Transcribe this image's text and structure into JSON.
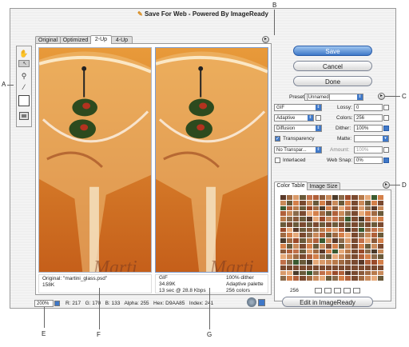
{
  "window": {
    "title": "Save For Web - Powered By ImageReady"
  },
  "tabs": [
    "Original",
    "Optimized",
    "2-Up",
    "4-Up"
  ],
  "active_tab": "2-Up",
  "tools": [
    "hand-icon",
    "slice-select-icon",
    "zoom-icon",
    "eyedropper-icon",
    "eyedropper-color-icon",
    "toggle-slices-icon"
  ],
  "left_pane": {
    "line1": "Original: \"martini_glass.psd\"",
    "line2": "158K",
    "watermark": "Marti"
  },
  "right_pane": {
    "col1": [
      "GIF",
      "34.89K",
      "13 sec @ 28.8 Kbps"
    ],
    "col2": [
      "100% dither",
      "Adaptive palette",
      "256 colors"
    ],
    "watermark": "Marti"
  },
  "buttons": {
    "save": "Save",
    "cancel": "Cancel",
    "done": "Done",
    "edit_imageready": "Edit in ImageReady"
  },
  "settings": {
    "preset_label": "Preset:",
    "preset_value": "[Unnamed]",
    "format": "GIF",
    "lossy_label": "Lossy:",
    "lossy_value": "0",
    "palette": "Adaptive",
    "colors_label": "Colors:",
    "colors_value": "256",
    "dither_algo": "Diffusion",
    "dither_label": "Dither:",
    "dither_value": "100%",
    "transparency_label": "Transparency",
    "matte_label": "Matte:",
    "transparency_dither": "No Transpar...",
    "amount_label": "Amount:",
    "amount_value": "100%",
    "interlaced_label": "Interlaced",
    "websnap_label": "Web Snap:",
    "websnap_value": "0%"
  },
  "panel_tabs": [
    "Color Table",
    "Image Size"
  ],
  "color_count": "256",
  "status": {
    "zoom": "200%",
    "r_label": "R:",
    "r": "217",
    "g_label": "G:",
    "g": "170",
    "b_label": "B:",
    "b": "133",
    "alpha_label": "Alpha:",
    "alpha": "255",
    "hex_label": "Hex:",
    "hex": "D9AA85",
    "index_label": "Index:",
    "index": "241"
  },
  "callouts": {
    "A": "A",
    "B": "B",
    "C": "C",
    "D": "D",
    "E": "E",
    "F": "F",
    "G": "G"
  },
  "colors": {
    "accent": "#3f78c8",
    "image_bg": "#e0832a"
  }
}
